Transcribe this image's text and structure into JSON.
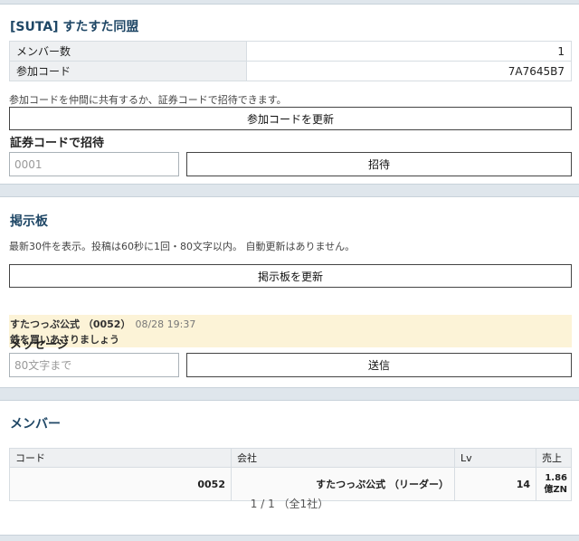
{
  "alliance": {
    "title": "[SUTA] すたすた同盟",
    "members_label": "メンバー数",
    "members_value": "1",
    "join_code_label": "参加コード",
    "join_code_value": "7A7645B7",
    "share_note": "参加コードを仲間に共有するか、証券コードで招待できます。",
    "refresh_code_button": "参加コードを更新",
    "invite_label": "証券コードで招待",
    "invite_placeholder": "0001",
    "invite_button": "招待"
  },
  "board": {
    "title": "掲示板",
    "note": "最新30件を表示。投稿は60秒に1回・80文字以内。 自動更新はありません。",
    "refresh_button": "掲示板を更新",
    "posts": [
      {
        "author": "すたつっぷ公式 （0052）",
        "date": "08/28 19:37",
        "text": "鉄を買いあさりましょう"
      }
    ],
    "message_label": "メッセージ",
    "message_placeholder": "80文字まで",
    "send_button": "送信"
  },
  "members": {
    "title": "メンバー",
    "columns": [
      "コード",
      "会社",
      "Lv",
      "売上"
    ],
    "rows": [
      {
        "code": "0052",
        "company": "すたつっぷ公式 （リーダー）",
        "lv": "14",
        "sales_line1": "1.86",
        "sales_line2": "億ZN"
      }
    ],
    "pager": "1 / 1 （全1社）"
  }
}
